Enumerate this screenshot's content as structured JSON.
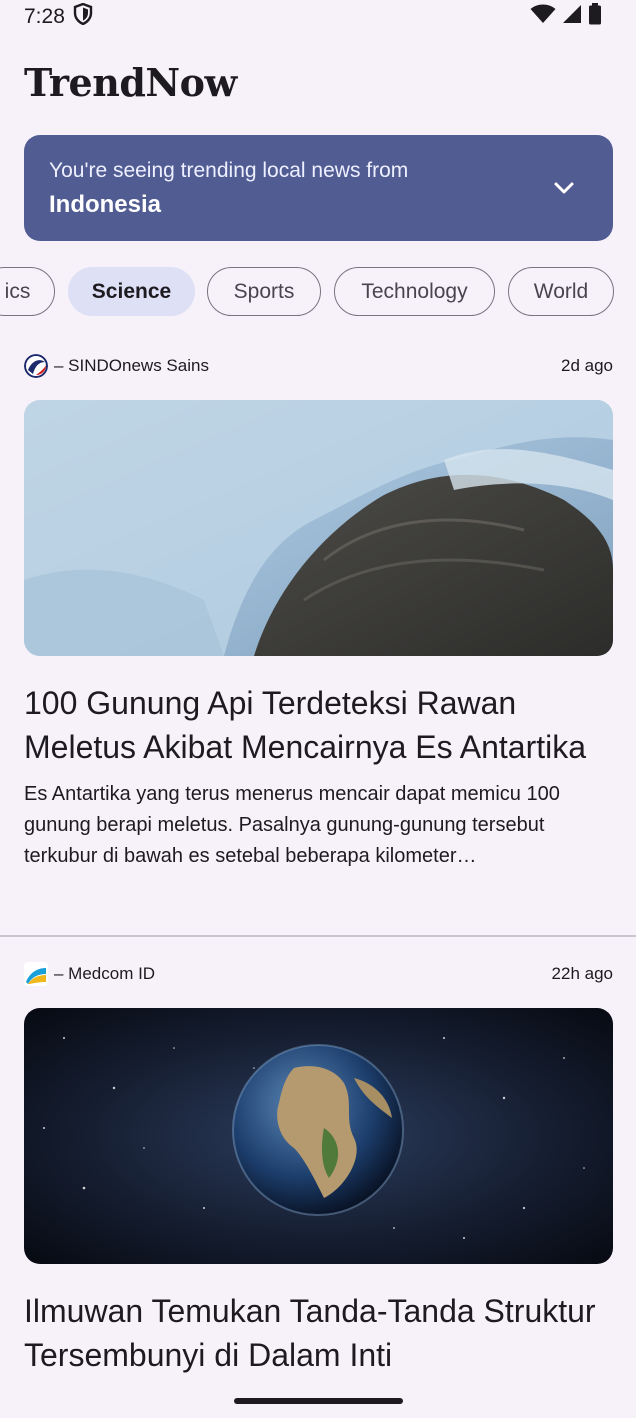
{
  "status_bar": {
    "time": "7:28",
    "icons": [
      "shield-icon",
      "wifi-icon",
      "signal-icon",
      "battery-icon"
    ]
  },
  "app": {
    "title": "TrendNow"
  },
  "banner": {
    "line1": "You're seeing trending local news from",
    "country": "Indonesia",
    "color": "#515c93"
  },
  "chips": [
    "ics",
    "Science",
    "Sports",
    "Technology",
    "World"
  ],
  "selected_chip": "Science",
  "articles": [
    {
      "source": "– SINDOnews Sains",
      "time": "2d ago",
      "headline": "100 Gunung Api Terdeteksi Rawan Meletus Akibat Mencairnya Es Antartika",
      "summary": "Es Antartika yang terus menerus mencair dapat memicu 100 gunung berapi meletus. Pasalnya gunung-gunung tersebut terkubur di bawah es setebal beberapa kilometer…"
    },
    {
      "source": "– Medcom ID",
      "time": "22h ago",
      "headline": "Ilmuwan Temukan Tanda-Tanda Struktur Tersembunyi di Dalam Inti"
    }
  ]
}
